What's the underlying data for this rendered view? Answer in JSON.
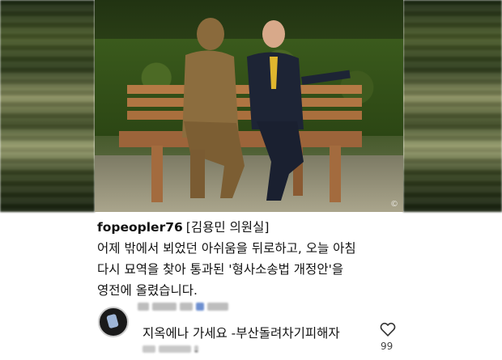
{
  "post": {
    "username": "fopeopler76",
    "office": "[김용민 의원실]",
    "caption_lines": [
      "어제 밖에서 뵈었던 아쉬움을 뒤로하고, 오늘 아침",
      "다시 묘역을 찾아 통과된 '형사소송법 개정안'을",
      "영전에 올렸습니다."
    ]
  },
  "comment": {
    "text": "지옥에나 가세요 -부산돌려차기피해자",
    "like_count": "99",
    "meta_suffix": "-"
  },
  "icons": {
    "like": "heart-icon",
    "avatar": "avatar"
  }
}
